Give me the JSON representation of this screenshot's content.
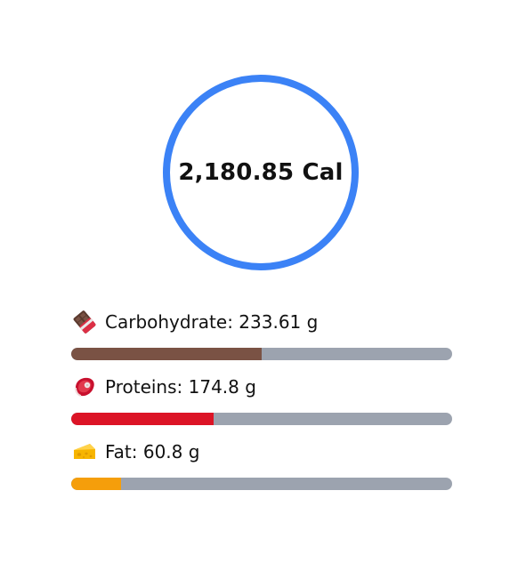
{
  "calories": {
    "display": "2,180.85 Cal",
    "ring_color": "#3b82f6"
  },
  "macros": [
    {
      "icon": "chocolate-bar-icon",
      "label": "Carbohydrate: 233.61 g",
      "fill_fraction": 0.5,
      "fill_color": "#7a5244"
    },
    {
      "icon": "meat-cut-icon",
      "label": "Proteins: 174.8 g",
      "fill_fraction": 0.374,
      "fill_color": "#dc1426"
    },
    {
      "icon": "cheese-wedge-icon",
      "label": "Fat: 60.8 g",
      "fill_fraction": 0.13,
      "fill_color": "#f59e0b"
    }
  ],
  "track_color": "#9ca3af"
}
